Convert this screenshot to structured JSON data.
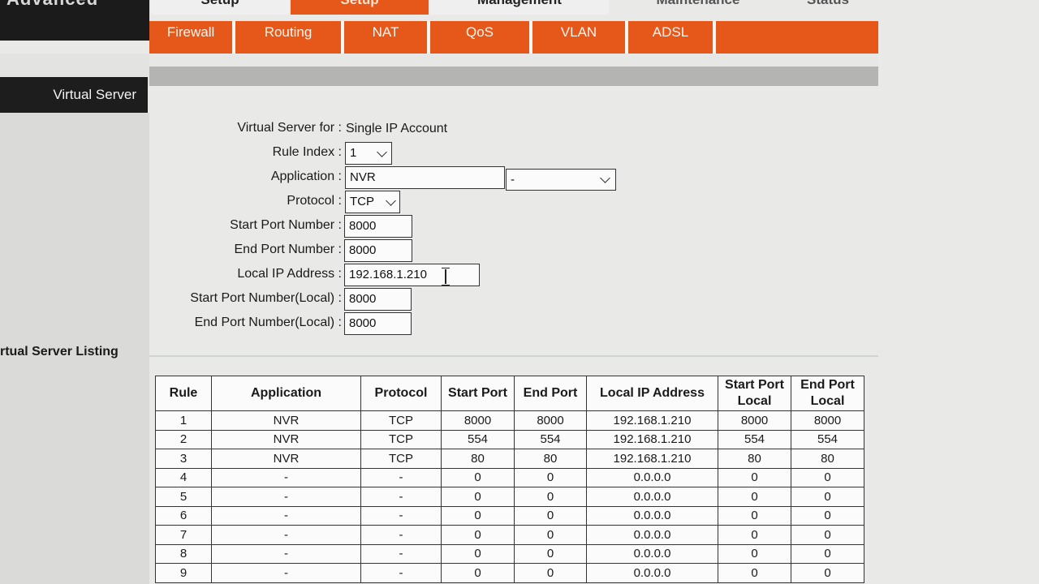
{
  "brand": "Advanced",
  "top_tabs": [
    "Setup",
    "Setup",
    "Management",
    "Maintenance",
    "Status"
  ],
  "sub_nav": [
    "Firewall",
    "Routing",
    "NAT",
    "QoS",
    "VLAN",
    "ADSL"
  ],
  "sidebar": {
    "title": "Virtual Server"
  },
  "form": {
    "virtual_server_for_label": "Virtual Server for :",
    "virtual_server_for_value": "Single IP Account",
    "rule_index_label": "Rule Index :",
    "rule_index_value": "1",
    "application_label": "Application :",
    "application_value": "NVR",
    "application_preset_value": "-",
    "protocol_label": "Protocol :",
    "protocol_value": "TCP",
    "start_port_label": "Start Port Number :",
    "start_port_value": "8000",
    "end_port_label": "End Port Number :",
    "end_port_value": "8000",
    "local_ip_label": "Local IP Address :",
    "local_ip_value": "192.168.1.210",
    "start_port_local_label": "Start Port Number(Local) :",
    "start_port_local_value": "8000",
    "end_port_local_label": "End Port Number(Local) :",
    "end_port_local_value": "8000"
  },
  "listing": {
    "title": "rtual Server Listing",
    "headers": {
      "rule": "Rule",
      "application": "Application",
      "protocol": "Protocol",
      "start_port": "Start Port",
      "end_port": "End Port",
      "local_ip": "Local IP Address",
      "start_port_local_1": "Start Port",
      "start_port_local_2": "Local",
      "end_port_local_1": "End Port",
      "end_port_local_2": "Local"
    },
    "rows": [
      [
        "1",
        "NVR",
        "TCP",
        "8000",
        "8000",
        "192.168.1.210",
        "8000",
        "8000"
      ],
      [
        "2",
        "NVR",
        "TCP",
        "554",
        "554",
        "192.168.1.210",
        "554",
        "554"
      ],
      [
        "3",
        "NVR",
        "TCP",
        "80",
        "80",
        "192.168.1.210",
        "80",
        "80"
      ],
      [
        "4",
        "-",
        "-",
        "0",
        "0",
        "0.0.0.0",
        "0",
        "0"
      ],
      [
        "5",
        "-",
        "-",
        "0",
        "0",
        "0.0.0.0",
        "0",
        "0"
      ],
      [
        "6",
        "-",
        "-",
        "0",
        "0",
        "0.0.0.0",
        "0",
        "0"
      ],
      [
        "7",
        "-",
        "-",
        "0",
        "0",
        "0.0.0.0",
        "0",
        "0"
      ],
      [
        "8",
        "-",
        "-",
        "0",
        "0",
        "0.0.0.0",
        "0",
        "0"
      ],
      [
        "9",
        "-",
        "-",
        "0",
        "0",
        "0.0.0.0",
        "0",
        "0"
      ]
    ]
  },
  "colors": {
    "accent": "#e6581a",
    "dark": "#1b1b1b",
    "page_bg": "#e9e9e7"
  }
}
